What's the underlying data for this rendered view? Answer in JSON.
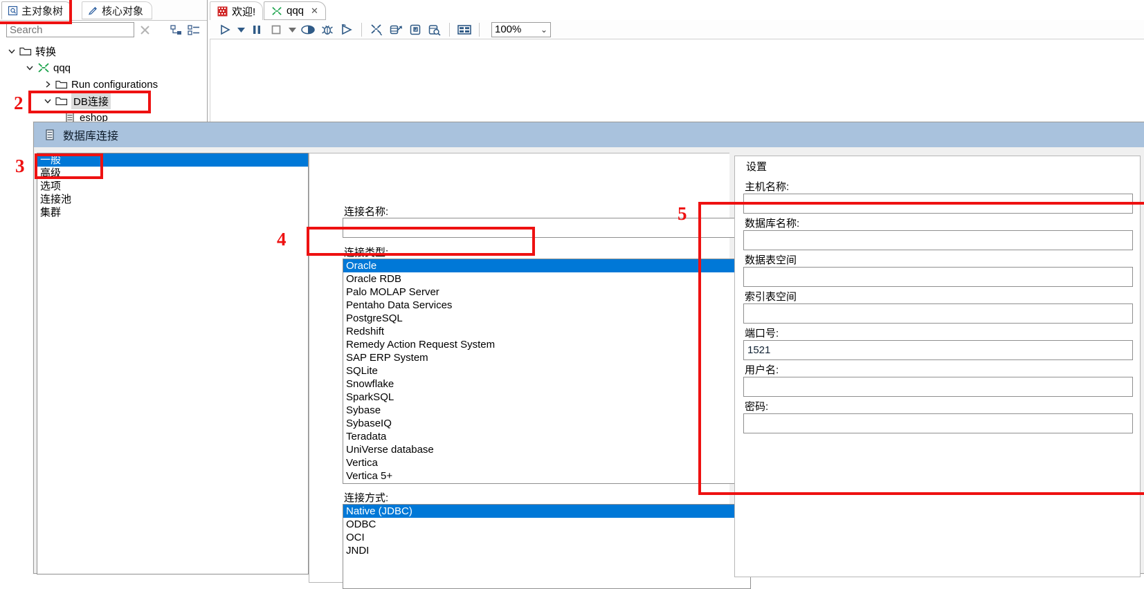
{
  "explorer": {
    "tabs": [
      {
        "label": "主对象树",
        "icon": "object-tree-icon",
        "active": true
      },
      {
        "label": "核心对象",
        "icon": "pencil-icon",
        "active": false
      }
    ],
    "search": {
      "value": "",
      "placeholder": "Search"
    },
    "toolbar_icons": [
      "clear-icon",
      "collapse-all-icon",
      "expand-all-icon"
    ],
    "tree": [
      {
        "label": "转换",
        "depth": 0,
        "twisty": "down",
        "icon": "folder-icon",
        "selected": false
      },
      {
        "label": "qqq",
        "depth": 1,
        "twisty": "down",
        "icon": "transformation-icon",
        "selected": false
      },
      {
        "label": "Run configurations",
        "depth": 2,
        "twisty": "right",
        "icon": "folder-icon",
        "selected": false
      },
      {
        "label": "DB连接",
        "depth": 2,
        "twisty": "down",
        "icon": "folder-icon",
        "selected": true
      },
      {
        "label": "eshop",
        "depth": 3,
        "twisty": "none",
        "icon": "database-icon",
        "selected": false
      }
    ]
  },
  "editor": {
    "tabs": [
      {
        "label": "欢迎!",
        "icon": "welcome-icon",
        "closable": false,
        "selected": false
      },
      {
        "label": "qqq",
        "icon": "transformation-icon",
        "closable": true,
        "selected": true
      }
    ],
    "close_glyph": "✕",
    "toolbar": [
      {
        "name": "run-icon",
        "glyph": "▷"
      },
      {
        "name": "run-dropdown-icon",
        "glyph": "▾"
      },
      {
        "name": "pause-icon",
        "glyph": "❚❚"
      },
      {
        "name": "stop-icon",
        "glyph": "□"
      },
      {
        "name": "stop-dropdown-icon",
        "glyph": "▾"
      },
      {
        "name": "preview-icon",
        "glyph": "◑"
      },
      {
        "name": "debug-icon",
        "glyph": "🐞"
      },
      {
        "name": "replay-icon",
        "glyph": "▷"
      },
      {
        "name": "transformation-settings-icon",
        "glyph": "✳"
      },
      {
        "name": "show-impact-icon",
        "glyph": "⇗"
      },
      {
        "name": "sql-icon",
        "glyph": "⤵"
      },
      {
        "name": "explore-db-icon",
        "glyph": "🔍"
      },
      {
        "name": "grid-icon",
        "glyph": "▤"
      }
    ],
    "zoom": {
      "value": "100%",
      "chevron": "⌄"
    }
  },
  "dialog": {
    "title": "数据库连接",
    "title_icon": "database-icon",
    "categories": [
      {
        "label": "一般",
        "selected": true
      },
      {
        "label": "高级",
        "selected": false
      },
      {
        "label": "选项",
        "selected": false
      },
      {
        "label": "连接池",
        "selected": false
      },
      {
        "label": "集群",
        "selected": false
      }
    ],
    "connection_name": {
      "label": "连接名称:",
      "value": ""
    },
    "connection_type": {
      "label": "连接类型:",
      "selected": "Oracle",
      "items": [
        "Oracle",
        "Oracle RDB",
        "Palo MOLAP Server",
        "Pentaho Data Services",
        "PostgreSQL",
        "Redshift",
        "Remedy Action Request System",
        "SAP ERP System",
        "SQLite",
        "Snowflake",
        "SparkSQL",
        "Sybase",
        "SybaseIQ",
        "Teradata",
        "UniVerse database",
        "Vertica",
        "Vertica 5+"
      ]
    },
    "access_method": {
      "label": "连接方式:",
      "selected": "Native (JDBC)",
      "items": [
        "Native (JDBC)",
        "ODBC",
        "OCI",
        "JNDI"
      ]
    },
    "settings": {
      "legend": "设置",
      "fields": [
        {
          "label": "主机名称:",
          "value": ""
        },
        {
          "label": "数据库名称:",
          "value": ""
        },
        {
          "label": "数据表空间",
          "value": ""
        },
        {
          "label": "索引表空间",
          "value": ""
        },
        {
          "label": "端口号:",
          "value": "1521"
        },
        {
          "label": "用户名:",
          "value": ""
        },
        {
          "label": "密码:",
          "value": ""
        }
      ]
    }
  },
  "annotations": [
    {
      "number": "2",
      "target": "db-connection-tree-node"
    },
    {
      "number": "3",
      "target": "category-general"
    },
    {
      "number": "4",
      "target": "connection-type-oracle"
    },
    {
      "number": "5",
      "target": "settings-group"
    }
  ],
  "colors": {
    "selection": "#0078d7",
    "annotation": "#ee1111",
    "dialog_title_bar": "#a9c2dd",
    "tree_highlight": "#dcdcdc"
  }
}
